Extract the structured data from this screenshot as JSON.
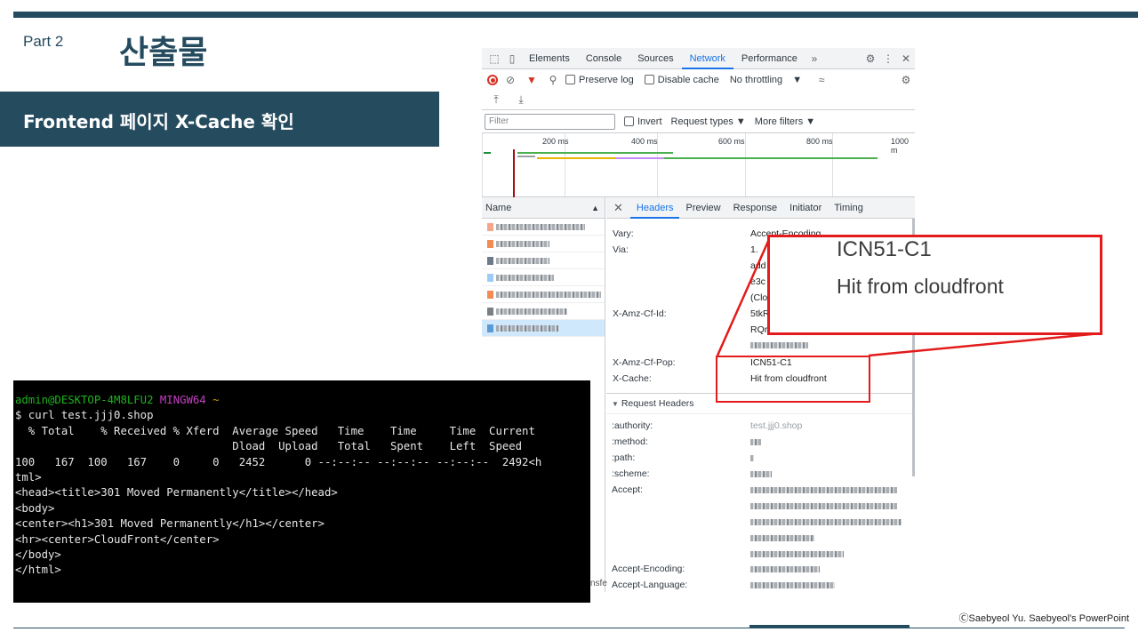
{
  "slide": {
    "part": "Part 2",
    "title": "산출물",
    "subtitle": "Frontend 페이지 X-Cache 확인",
    "copyright": "ⒸSaebyeol Yu. Saebyeol's PowerPoint"
  },
  "devtools": {
    "tabs": [
      "Elements",
      "Console",
      "Sources",
      "Network",
      "Performance"
    ],
    "active_tab": "Network",
    "toolbar": {
      "preserve_log": "Preserve log",
      "disable_cache": "Disable cache",
      "throttling": "No throttling"
    },
    "filter": {
      "placeholder": "Filter",
      "invert": "Invert",
      "request_types": "Request types",
      "more_filters": "More filters"
    },
    "timeline_ticks": [
      "200 ms",
      "400 ms",
      "600 ms",
      "800 ms",
      "1000 m"
    ],
    "name_header": "Name",
    "detail_tabs": [
      "Headers",
      "Preview",
      "Response",
      "Initiator",
      "Timing"
    ],
    "active_detail_tab": "Headers",
    "response_headers": [
      {
        "name": "Vary:",
        "value": "Accept-Encoding"
      },
      {
        "name": "Via:",
        "value": "1."
      },
      {
        "name": "X-Amz-Cf-Id:",
        "value": "5tkR"
      },
      {
        "name": "X-Amz-Cf-Pop:",
        "value": "ICN51-C1"
      },
      {
        "name": "X-Cache:",
        "value": "Hit from cloudfront"
      }
    ],
    "via_fragments": [
      "add",
      "e3c",
      "(Clo"
    ],
    "cf_id_fragment": "RQr",
    "request_section": "Request Headers",
    "request_headers": [
      {
        "name": ":authority:",
        "value": "test.jjj0.shop"
      },
      {
        "name": ":method:",
        "value": ""
      },
      {
        "name": ":path:",
        "value": ""
      },
      {
        "name": ":scheme:",
        "value": ""
      },
      {
        "name": "Accept:",
        "value": ""
      },
      {
        "name": "Accept-Encoding:",
        "value": ""
      },
      {
        "name": "Accept-Language:",
        "value": ""
      }
    ]
  },
  "zoom": {
    "pop": "ICN51-C1",
    "cache": "Hit from cloudfront"
  },
  "terminal": {
    "prompt_user": "admin@DESKTOP-4M8LFU2",
    "prompt_host": "MINGW64",
    "prompt_dir": "~",
    "lines": [
      "$ curl test.jjj0.shop",
      "  % Total    % Received % Xferd  Average Speed   Time    Time     Time  Current",
      "                                 Dload  Upload   Total   Spent    Left  Speed",
      "100   167  100   167    0     0   2452      0 --:--:-- --:--:-- --:--:--  2492<h",
      "tml>",
      "<head><title>301 Moved Permanently</title></head>",
      "<body>",
      "<center><h1>301 Moved Permanently</h1></center>",
      "<hr><center>CloudFront</center>",
      "</body>",
      "</html>"
    ]
  },
  "edge_text": "nsfe",
  "colors": {
    "brand": "#254b5e",
    "highlight": "#e31b1b",
    "devtools_accent": "#1a73e8"
  }
}
